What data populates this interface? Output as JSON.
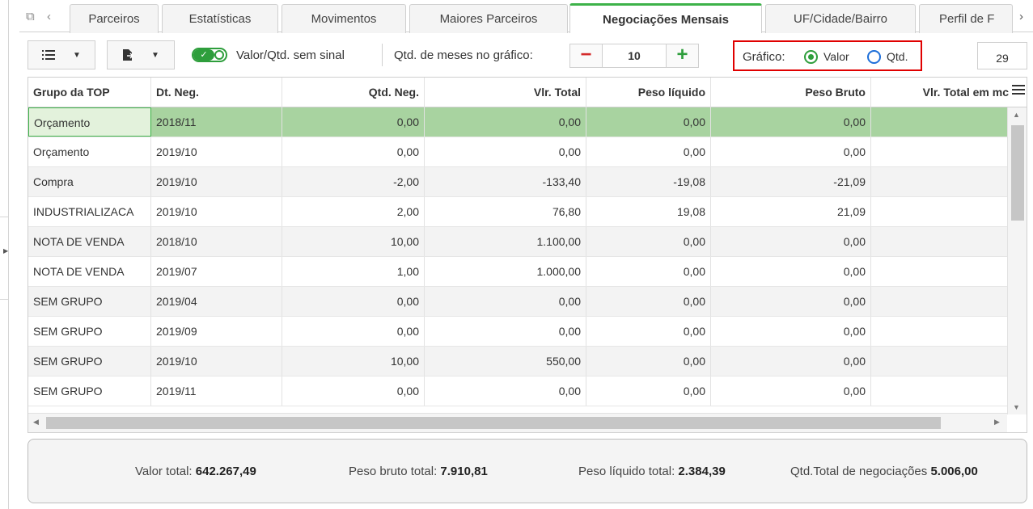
{
  "tabs": [
    "Parceiros",
    "Estatísticas",
    "Movimentos",
    "Maiores Parceiros",
    "Negociações Mensais",
    "UF/Cidade/Bairro",
    "Perfil de F"
  ],
  "active_tab": "Negociações Mensais",
  "toolbar": {
    "toggle_text": "Valor/Qtd. sem sinal",
    "months_label": "Qtd. de meses no gráfico:",
    "months_value": "10",
    "grafico_label": "Gráfico:",
    "opt_valor": "Valor",
    "opt_qtd": "Qtd.",
    "selected_option": "Valor",
    "record_count": "29"
  },
  "columns": [
    "Grupo da TOP",
    "Dt. Neg.",
    "Qtd. Neg.",
    "Vlr. Total",
    "Peso líquido",
    "Peso Bruto",
    "Vlr. Total em mc"
  ],
  "rows": [
    [
      "Orçamento",
      "2018/11",
      "0,00",
      "0,00",
      "0,00",
      "0,00",
      ""
    ],
    [
      "Orçamento",
      "2019/10",
      "0,00",
      "0,00",
      "0,00",
      "0,00",
      ""
    ],
    [
      "Compra",
      "2019/10",
      "-2,00",
      "-133,40",
      "-19,08",
      "-21,09",
      ""
    ],
    [
      "INDUSTRIALIZACA",
      "2019/10",
      "2,00",
      "76,80",
      "19,08",
      "21,09",
      ""
    ],
    [
      "NOTA DE VENDA",
      "2018/10",
      "10,00",
      "1.100,00",
      "0,00",
      "0,00",
      ""
    ],
    [
      "NOTA DE VENDA",
      "2019/07",
      "1,00",
      "1.000,00",
      "0,00",
      "0,00",
      ""
    ],
    [
      "SEM GRUPO",
      "2019/04",
      "0,00",
      "0,00",
      "0,00",
      "0,00",
      ""
    ],
    [
      "SEM GRUPO",
      "2019/09",
      "0,00",
      "0,00",
      "0,00",
      "0,00",
      ""
    ],
    [
      "SEM GRUPO",
      "2019/10",
      "10,00",
      "550,00",
      "0,00",
      "0,00",
      ""
    ],
    [
      "SEM GRUPO",
      "2019/11",
      "0,00",
      "0,00",
      "0,00",
      "0,00",
      ""
    ]
  ],
  "footer": {
    "valor_label": "Valor total:",
    "valor": "642.267,49",
    "peso_bruto_label": "Peso bruto total:",
    "peso_bruto": "7.910,81",
    "peso_liquido_label": "Peso líquido total:",
    "peso_liquido": "2.384,39",
    "qtd_label": "Qtd.Total de negociações",
    "qtd": "5.006,00"
  },
  "colors": {
    "accent_green": "#3db249",
    "selected_row": "#a8d3a0",
    "highlight_red": "#e00000",
    "radio_blue": "#1e6fd9"
  }
}
